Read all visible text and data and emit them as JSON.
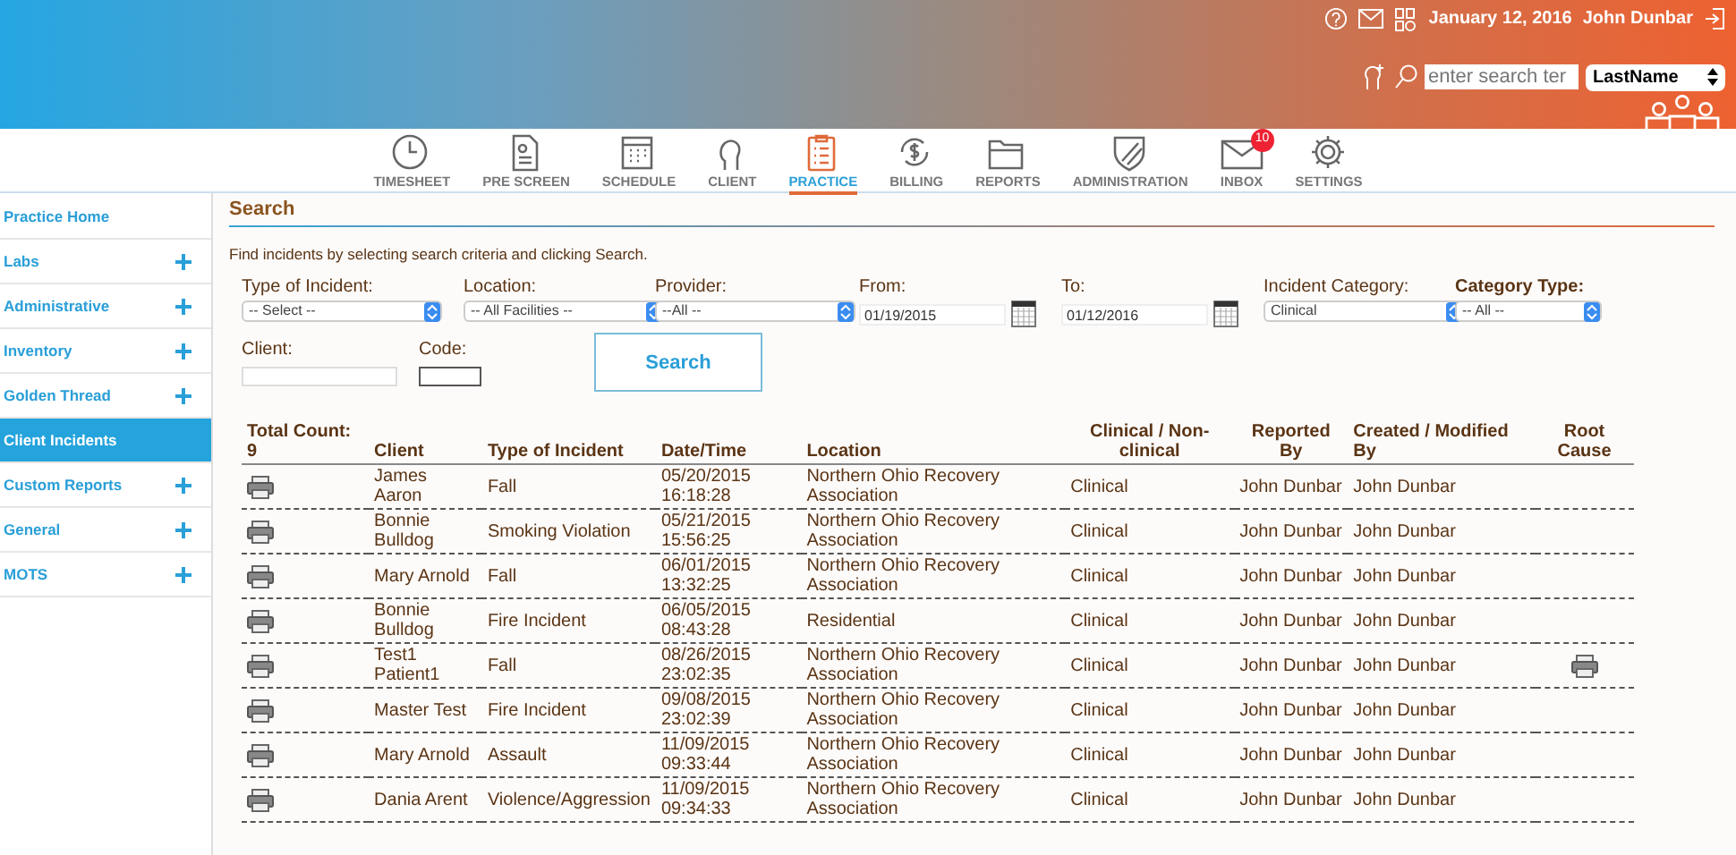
{
  "header": {
    "date": "January 12, 2016",
    "user": "John Dunbar",
    "search": {
      "placeholder": "enter search ter"
    },
    "search_by": "LastName"
  },
  "nav": [
    {
      "label": "TIMESHEET",
      "selected": false
    },
    {
      "label": "PRE SCREEN",
      "selected": false
    },
    {
      "label": "SCHEDULE",
      "selected": false
    },
    {
      "label": "CLIENT",
      "selected": false
    },
    {
      "label": "PRACTICE",
      "selected": true
    },
    {
      "label": "BILLING",
      "selected": false
    },
    {
      "label": "REPORTS",
      "selected": false
    },
    {
      "label": "ADMINISTRATION",
      "selected": false
    },
    {
      "label": "INBOX",
      "selected": false,
      "badge": "10"
    },
    {
      "label": "SETTINGS",
      "selected": false
    }
  ],
  "sidebar": {
    "items": [
      {
        "label": "Practice Home",
        "expandable": false,
        "selected": false
      },
      {
        "label": "Labs",
        "expandable": true,
        "selected": false
      },
      {
        "label": "Administrative",
        "expandable": true,
        "selected": false
      },
      {
        "label": "Inventory",
        "expandable": true,
        "selected": false
      },
      {
        "label": "Golden Thread",
        "expandable": true,
        "selected": false
      },
      {
        "label": "Client Incidents",
        "expandable": false,
        "selected": true
      },
      {
        "label": "Custom Reports",
        "expandable": true,
        "selected": false
      },
      {
        "label": "General",
        "expandable": true,
        "selected": false
      },
      {
        "label": "MOTS",
        "expandable": true,
        "selected": false
      }
    ]
  },
  "search": {
    "title": "Search",
    "hint": "Find incidents by selecting search criteria and clicking Search.",
    "filters": [
      {
        "label": "Type of Incident:",
        "kind": "select",
        "value": "-- Select --",
        "emphasized": false
      },
      {
        "label": "Location:",
        "kind": "select",
        "value": "-- All Facilities --",
        "emphasized": false
      },
      {
        "label": "Provider:",
        "kind": "select",
        "value": "--All --",
        "emphasized": false
      },
      {
        "label": "From:",
        "kind": "date",
        "value": "01/19/2015",
        "emphasized": false
      },
      {
        "label": "To:",
        "kind": "date",
        "value": "01/12/2016",
        "emphasized": false
      },
      {
        "label": "Incident Category:",
        "kind": "select",
        "value": "Clinical",
        "emphasized": false
      },
      {
        "label": "Category Type:",
        "kind": "select",
        "value": "-- All --",
        "emphasized": true
      }
    ],
    "client_label": "Client:",
    "code_label": "Code:",
    "button": "Search"
  },
  "table": {
    "columns": [
      "Total Count:\n9",
      "Client",
      "Type of Incident",
      "Date/Time",
      "Location",
      "Clinical / Non-\nclinical",
      "Reported\nBy",
      "Created / Modified\nBy",
      "Root\nCause"
    ],
    "rows": [
      {
        "client": "James Aaron",
        "type": "Fall",
        "datetime": "05/20/2015\n16:18:28",
        "location": "Northern Ohio Recovery\nAssociation",
        "clinical": "Clinical",
        "reported_by": "John Dunbar",
        "modified_by": "John Dunbar",
        "root_cause": false
      },
      {
        "client": "Bonnie\nBulldog",
        "type": "Smoking Violation",
        "datetime": "05/21/2015\n15:56:25",
        "location": "Northern Ohio Recovery\nAssociation",
        "clinical": "Clinical",
        "reported_by": "John Dunbar",
        "modified_by": "John Dunbar",
        "root_cause": false
      },
      {
        "client": "Mary Arnold",
        "type": "Fall",
        "datetime": "06/01/2015\n13:32:25",
        "location": "Northern Ohio Recovery\nAssociation",
        "clinical": "Clinical",
        "reported_by": "John Dunbar",
        "modified_by": "John Dunbar",
        "root_cause": false
      },
      {
        "client": "Bonnie\nBulldog",
        "type": "Fire Incident",
        "datetime": "06/05/2015\n08:43:28",
        "location": "Residential",
        "clinical": "Clinical",
        "reported_by": "John Dunbar",
        "modified_by": "John Dunbar",
        "root_cause": false
      },
      {
        "client": "Test1\nPatient1",
        "type": "Fall",
        "datetime": "08/26/2015\n23:02:35",
        "location": "Northern Ohio Recovery\nAssociation",
        "clinical": "Clinical",
        "reported_by": "John Dunbar",
        "modified_by": "John Dunbar",
        "root_cause": true
      },
      {
        "client": "Master Test",
        "type": "Fire Incident",
        "datetime": "09/08/2015\n23:02:39",
        "location": "Northern Ohio Recovery\nAssociation",
        "clinical": "Clinical",
        "reported_by": "John Dunbar",
        "modified_by": "John Dunbar",
        "root_cause": false
      },
      {
        "client": "Mary Arnold",
        "type": "Assault",
        "datetime": "11/09/2015\n09:33:44",
        "location": "Northern Ohio Recovery\nAssociation",
        "clinical": "Clinical",
        "reported_by": "John Dunbar",
        "modified_by": "John Dunbar",
        "root_cause": false
      },
      {
        "client": "Dania Arent",
        "type": "Violence/Aggression",
        "datetime": "11/09/2015\n09:34:33",
        "location": "Northern Ohio Recovery\nAssociation",
        "clinical": "Clinical",
        "reported_by": "John Dunbar",
        "modified_by": "John Dunbar",
        "root_cause": false
      }
    ]
  }
}
